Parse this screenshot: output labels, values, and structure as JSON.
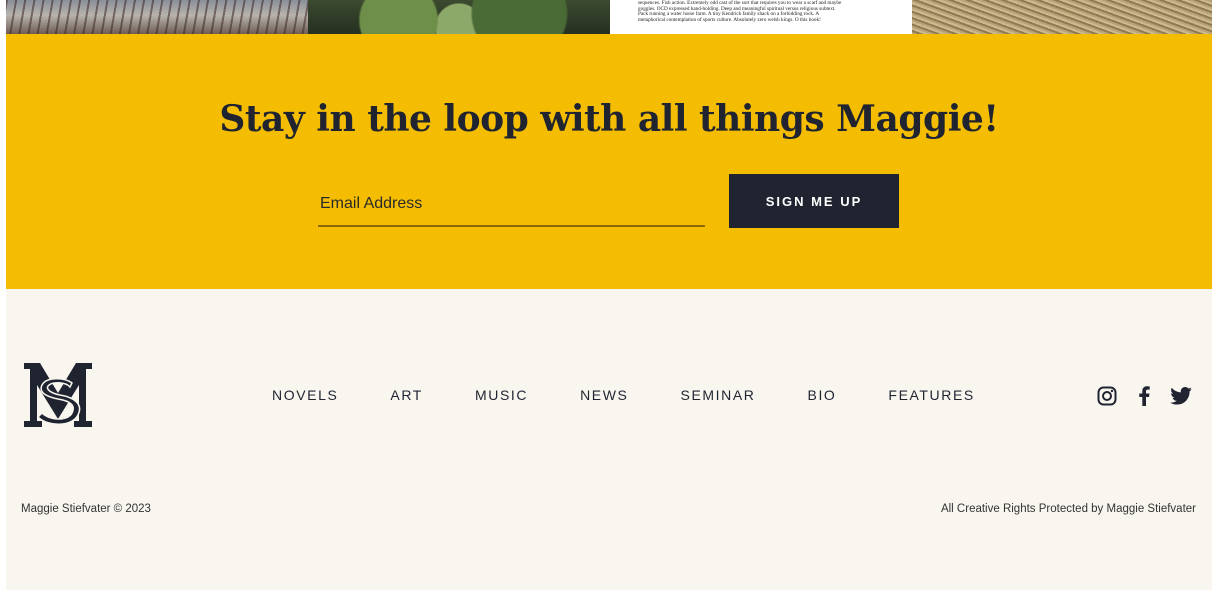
{
  "top_strip": {
    "book_excerpt": [
      "sequences. Fish action. Extremely odd cast of the sort that requires you to wear a scarf and maybe",
      "goggles. OCD expressed hand-holding. Deep and meaningful spiritual versus religious subtext.",
      "Pack running a water horse farm. A tiny Kendrick family shack on a forbidding rock. A",
      "metaphorical contemplation of sports culture. Absolutely zero welsh kings. O this book!"
    ]
  },
  "newsletter": {
    "title": "Stay in the loop with all things Maggie!",
    "email_placeholder": "Email Address",
    "email_value": "",
    "button_label": "SIGN ME UP",
    "background_color": "#f4bd02",
    "button_color": "#1f2430"
  },
  "footer": {
    "logo": "ms-monogram-logo",
    "nav": [
      {
        "label": "NOVELS"
      },
      {
        "label": "ART"
      },
      {
        "label": "MUSIC"
      },
      {
        "label": "NEWS"
      },
      {
        "label": "SEMINAR"
      },
      {
        "label": "BIO"
      },
      {
        "label": "FEATURES"
      }
    ],
    "social_icons": [
      "instagram-icon",
      "facebook-icon",
      "twitter-icon"
    ],
    "copyright": "Maggie Stiefvater © 2023",
    "rights": "All Creative Rights Protected by Maggie Stiefvater",
    "background_color": "#f9f6f0"
  }
}
